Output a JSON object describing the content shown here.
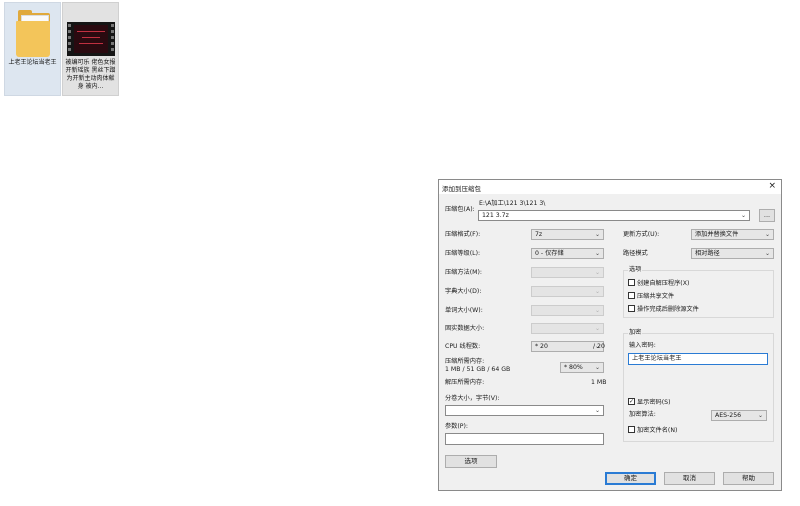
{
  "desktop": {
    "icons": [
      {
        "label": "上老王论坛当老王"
      },
      {
        "label": "被编可乐 佬色女报开新瑶族 黑丝下蹭为开新主动肉体献身 被内..."
      }
    ]
  },
  "dialog": {
    "title": "添加到压缩包",
    "close_glyph": "×",
    "archive": {
      "label": "压缩包(A):",
      "path": "E:\\A加工\\121 3\\121 3\\",
      "value": "121 3.7z",
      "browse": "..."
    },
    "left": {
      "format": {
        "label": "压缩格式(F):",
        "value": "7z"
      },
      "level": {
        "label": "压缩等级(L):",
        "value": "0 - 仅存储"
      },
      "method": {
        "label": "压缩方法(M):",
        "value": ""
      },
      "dict": {
        "label": "字典大小(D):",
        "value": ""
      },
      "word": {
        "label": "单词大小(W):",
        "value": ""
      },
      "solid": {
        "label": "固实数据大小:",
        "value": ""
      },
      "threads": {
        "label": "CPU 线程数:",
        "value": "* 20",
        "total": "/ 20"
      },
      "mem_compress": {
        "label": "压缩所需内存:",
        "detail": "1 MB / 51 GB / 64 GB",
        "value": "* 80%",
        "size": "1 MB"
      },
      "mem_decompress": {
        "label": "解压所需内存:",
        "size": "1 MB"
      },
      "volume": {
        "label": "分卷大小，字节(V):",
        "value": ""
      },
      "params": {
        "label": "参数(P):",
        "value": ""
      },
      "options_button": "选项"
    },
    "right": {
      "update": {
        "label": "更新方式(U):",
        "value": "添加并替换文件"
      },
      "path_mode": {
        "label": "路径模式",
        "value": "相对路径"
      },
      "options": {
        "title": "选项",
        "items": [
          {
            "label": "创建自解压程序(X)",
            "checked": false
          },
          {
            "label": "压缩共享文件",
            "checked": false
          },
          {
            "label": "操作完成后删除源文件",
            "checked": false
          }
        ]
      },
      "encryption": {
        "title": "加密",
        "password_label": "输入密码:",
        "password_value": "上老王论坛当老王",
        "show_password": {
          "label": "显示密码(S)",
          "checked": true
        },
        "method_label": "加密算法:",
        "method_value": "AES-256",
        "encrypt_names": {
          "label": "加密文件名(N)",
          "checked": false
        }
      }
    },
    "buttons": {
      "ok": "确定",
      "cancel": "取消",
      "help": "帮助"
    },
    "check_glyph": "✓",
    "chevron_glyph": "⌄"
  }
}
